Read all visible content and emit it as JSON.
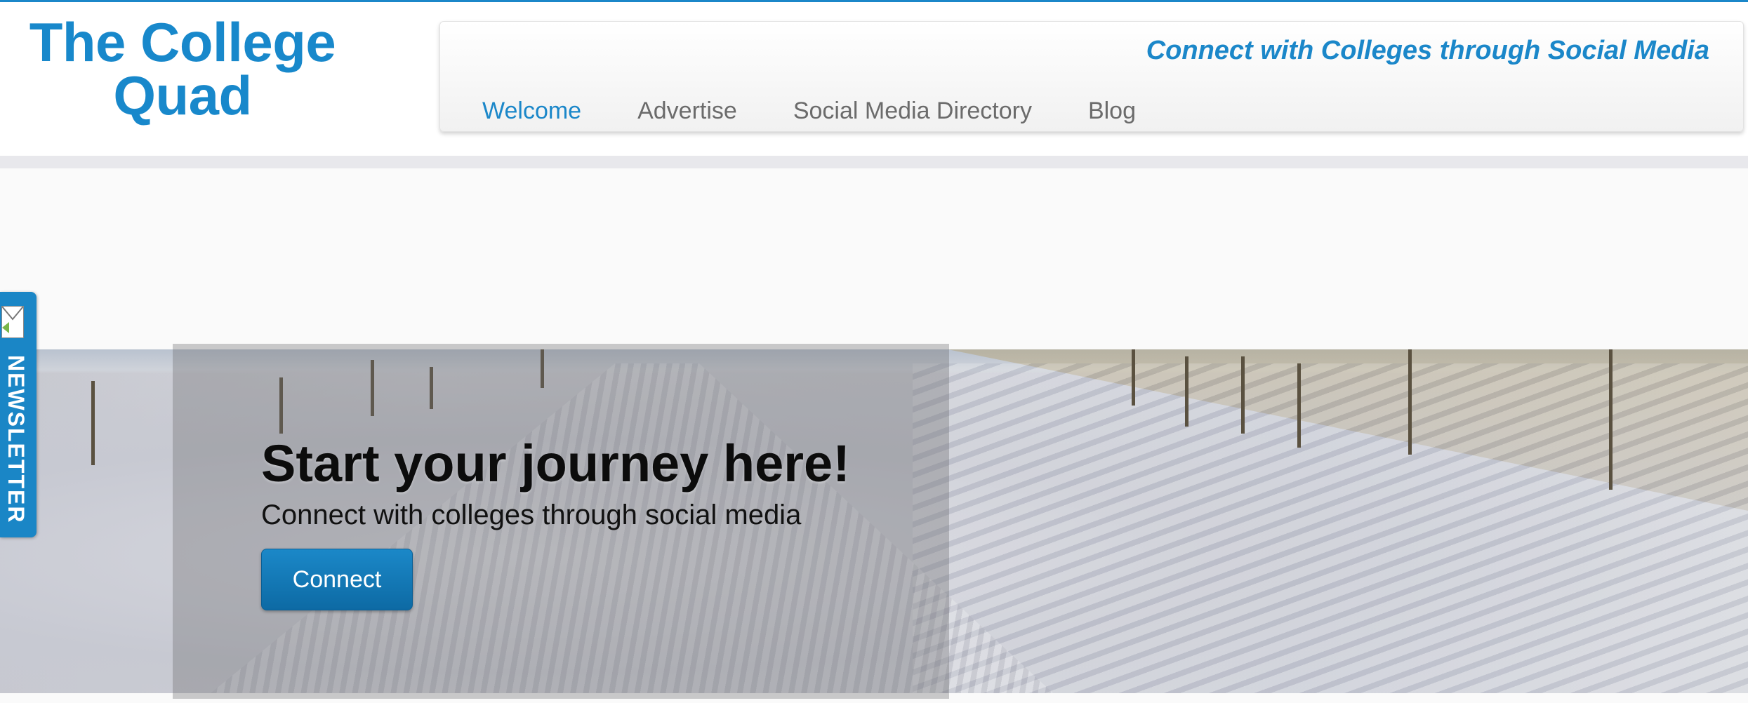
{
  "site": {
    "logo_line1": "The College",
    "logo_line2": "Quad",
    "tagline": "Connect with Colleges through Social Media"
  },
  "nav": {
    "items": [
      {
        "label": "Welcome",
        "active": true
      },
      {
        "label": "Advertise",
        "active": false
      },
      {
        "label": "Social Media Directory",
        "active": false
      },
      {
        "label": "Blog",
        "active": false
      }
    ]
  },
  "hero": {
    "title": "Start your journey here!",
    "subtitle": "Connect with colleges through social media",
    "button_label": "Connect"
  },
  "sidebar_tab": {
    "label": "NEWSLETTER",
    "icon": "envelope-icon"
  },
  "colors": {
    "brand_blue": "#1b87c9",
    "button_blue": "#0d6aa4"
  }
}
